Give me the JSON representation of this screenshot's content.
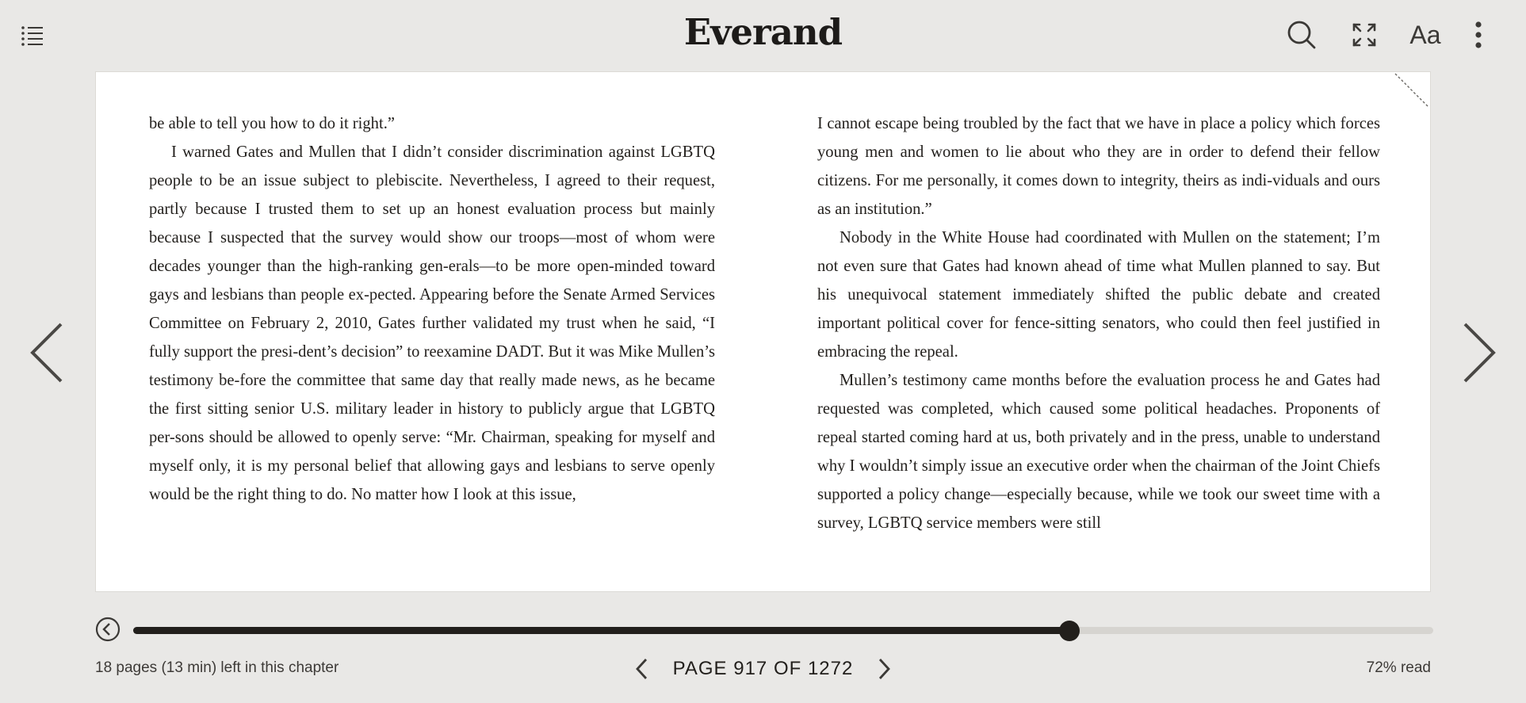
{
  "header": {
    "brand": "Everand",
    "icons": {
      "toc": "table-of-contents-icon",
      "search": "search-icon",
      "fullscreen": "fullscreen-icon",
      "text_settings": "text-settings-icon",
      "more": "more-vertical-icon"
    },
    "text_settings_label": "Aa"
  },
  "book": {
    "left_column": [
      {
        "text": "be able to tell you how to do it right.”",
        "indent": false
      },
      {
        "text": "I warned Gates and Mullen that I didn’t consider discrimination against LGBTQ people to be an issue subject to plebiscite. Nevertheless, I agreed to their request, partly because I trusted them to set up an honest evaluation process but mainly because I suspected that the survey would show our troops—most of whom were decades younger than the high-ranking gen-erals—to be more open-minded toward gays and lesbians than people ex-pected. Appearing before the Senate Armed Services Committee on February 2, 2010, Gates further validated my trust when he said, “I fully support the presi-dent’s decision” to reexamine DADT. But it was Mike Mullen’s testimony be-fore the committee that same day that really made news, as he became the first sitting senior U.S. military leader in history to publicly argue that LGBTQ per-sons should be allowed to openly serve: “Mr. Chairman, speaking for myself and myself only, it is my personal belief that allowing gays and lesbians to serve openly would be the right thing to do. No matter how I look at this issue,",
        "indent": true
      }
    ],
    "right_column": [
      {
        "text": "I cannot escape being troubled by the fact that we have in place a policy which forces young men and women to lie about who they are in order to defend their fellow citizens. For me personally, it comes down to integrity, theirs as indi-viduals and ours as an institution.”",
        "indent": false
      },
      {
        "text": "Nobody in the White House had coordinated with Mullen on the statement; I’m not even sure that Gates had known ahead of time what Mullen planned to say. But his unequivocal statement immediately shifted the public debate and created important political cover for fence-sitting senators, who could then feel justified in embracing the repeal.",
        "indent": true
      },
      {
        "text": "Mullen’s testimony came months before the evaluation process he and Gates had requested was completed, which caused some political headaches. Proponents of repeal started coming hard at us, both privately and in the press, unable to understand why I wouldn’t simply issue an executive order when the chairman of the Joint Chiefs supported a policy change—especially because, while we took our sweet time with a survey, LGBTQ service members were still",
        "indent": true
      }
    ]
  },
  "navigation": {
    "prev_icon": "chevron-left-icon",
    "next_icon": "chevron-right-icon"
  },
  "footer": {
    "chapter_remaining": "18 pages (13 min) left in this chapter",
    "page_label": "PAGE 917 OF 1272",
    "percent_read": "72% read",
    "progress_fraction": 0.72,
    "back_icon": "back-circle-icon"
  }
}
